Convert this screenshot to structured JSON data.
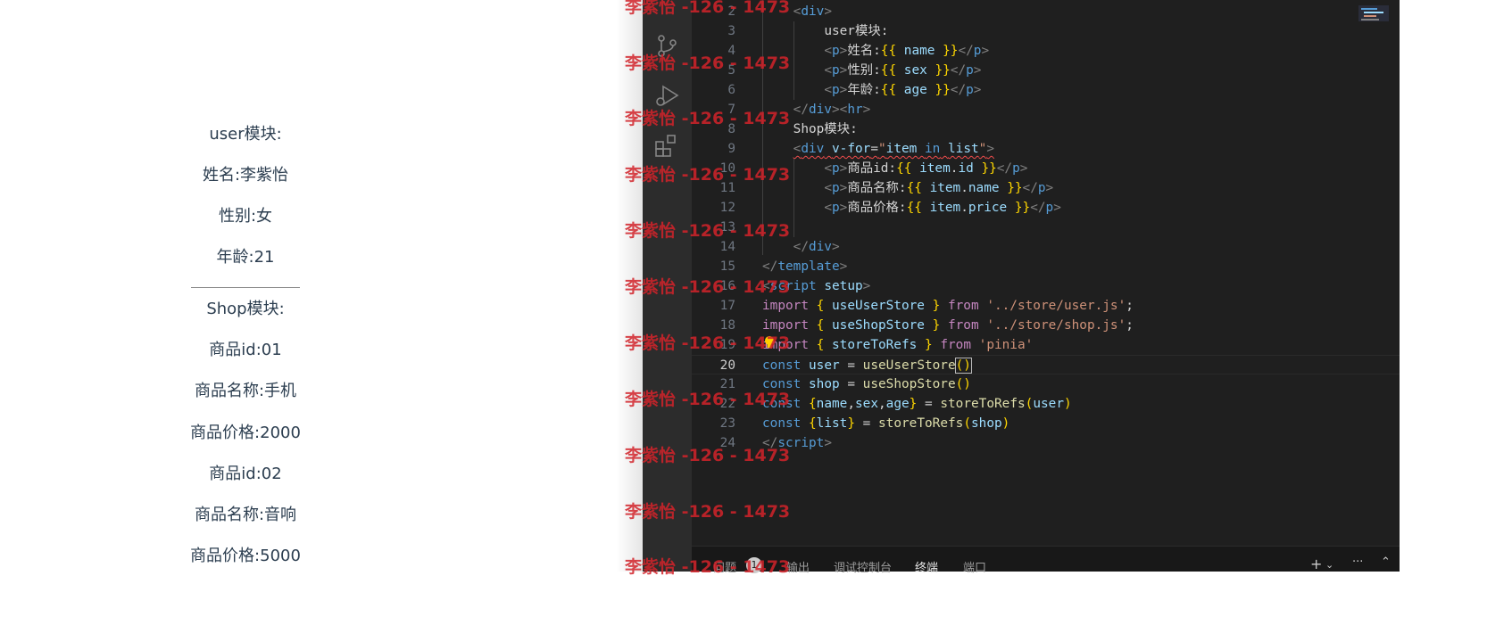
{
  "preview": {
    "lines": [
      "user模块:",
      "姓名:李紫怡",
      "性别:女",
      "年龄:21",
      "Shop模块:",
      "商品id:01",
      "商品名称:手机",
      "商品价格:2000",
      "商品id:02",
      "商品名称:音响",
      "商品价格:5000"
    ]
  },
  "watermark": {
    "text": "李紫怡 -126 - 1473"
  },
  "activity_bar": {
    "icons": [
      "source-control-icon",
      "run-debug-icon",
      "extensions-icon"
    ]
  },
  "editor": {
    "active_line": "20",
    "line_numbers": [
      "2",
      "3",
      "4",
      "5",
      "6",
      "7",
      "8",
      "9",
      "10",
      "11",
      "12",
      "13",
      "14",
      "15",
      "16",
      "17",
      "18",
      "19",
      "20",
      "21",
      "22",
      "23",
      "24"
    ]
  },
  "panel": {
    "tabs": [
      "问题",
      "输出",
      "调试控制台",
      "终端",
      "端口"
    ],
    "problems_count": "1",
    "active_tab": "终端",
    "add_glyph": "+",
    "more_glyph": "···"
  },
  "colors": {
    "editor_bg": "#1f1f1f",
    "activity_bar_bg": "#2c2c2c",
    "watermark": "#d2232a"
  }
}
